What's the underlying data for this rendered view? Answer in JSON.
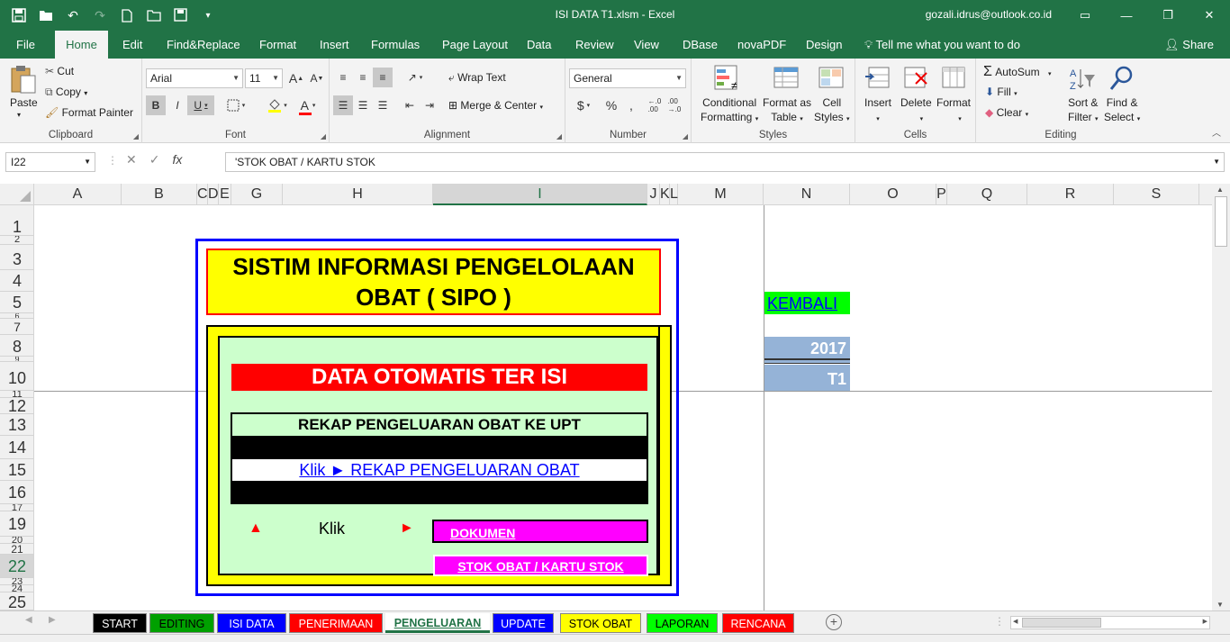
{
  "window": {
    "title": "ISI DATA T1.xlsm  -  Excel",
    "account": "gozali.idrus@outlook.co.id"
  },
  "ribbon_tabs": [
    "File",
    "Home",
    "Edit",
    "Find&Replace",
    "Format",
    "Insert",
    "Formulas",
    "Page Layout",
    "Data",
    "Review",
    "View",
    "DBase",
    "novaPDF",
    "Design"
  ],
  "active_tab": "Home",
  "tell_me": "Tell me what you want to do",
  "share_label": "Share",
  "clipboard": {
    "paste": "Paste",
    "cut": "Cut",
    "copy": "Copy",
    "format_painter": "Format Painter",
    "label": "Clipboard"
  },
  "font": {
    "name": "Arial",
    "size": "11",
    "bold": "B",
    "italic": "I",
    "underline": "U",
    "label": "Font"
  },
  "alignment": {
    "wrap_text": "Wrap Text",
    "merge_center": "Merge & Center",
    "label": "Alignment"
  },
  "number": {
    "format": "General",
    "currency": "$",
    "percent": "%",
    "comma": ",",
    "label": "Number"
  },
  "styles": {
    "conditional_1": "Conditional",
    "conditional_2": "Formatting",
    "format_table_1": "Format as",
    "format_table_2": "Table",
    "cell_styles_1": "Cell",
    "cell_styles_2": "Styles",
    "label": "Styles"
  },
  "cells": {
    "insert": "Insert",
    "delete": "Delete",
    "format": "Format",
    "label": "Cells"
  },
  "editing": {
    "autosum": "AutoSum",
    "fill": "Fill",
    "clear": "Clear",
    "sort_1": "Sort &",
    "sort_2": "Filter",
    "find_1": "Find &",
    "find_2": "Select",
    "label": "Editing"
  },
  "formula_bar": {
    "name_box": "I22",
    "formula": "'STOK OBAT / KARTU STOK"
  },
  "columns": [
    "A",
    "B",
    "C",
    "D",
    "E",
    "G",
    "H",
    "I",
    "J",
    "K",
    "L",
    "M",
    "N",
    "O",
    "P",
    "Q",
    "R",
    "S"
  ],
  "rows": [
    "1",
    "2",
    "3",
    "4",
    "5",
    "6",
    "7",
    "8",
    "9",
    "10",
    "11",
    "12",
    "13",
    "14",
    "15",
    "16",
    "17",
    "19",
    "20",
    "21",
    "22",
    "23",
    "24",
    "25"
  ],
  "dashboard": {
    "title_line1": "SISTIM INFORMASI PENGELOLAAN",
    "title_line2": "OBAT   ( SIPO )",
    "banner": "DATA OTOMATIS TER ISI",
    "rekap_title": "REKAP PENGELUARAN OBAT KE UPT",
    "rekap_link": "Klik ►  REKAP PENGELUARAN OBAT",
    "klik_arrow_up": "▲",
    "klik_label": "Klik",
    "klik_arrow_right": "►",
    "dokumen_button": "DOKUMEN",
    "stok_button": "STOK OBAT / KARTU STOK"
  },
  "side_panel": {
    "kembali": "KEMBALI",
    "year": "2017",
    "period": "T1"
  },
  "sheet_tabs": [
    {
      "label": "START",
      "bg": "#000000",
      "fg": "#ffffff"
    },
    {
      "label": "EDITING",
      "bg": "#00a000",
      "fg": "#000000"
    },
    {
      "label": "ISI DATA",
      "bg": "#0000ff",
      "fg": "#ffffff"
    },
    {
      "label": "PENERIMAAN",
      "bg": "#ff0000",
      "fg": "#ffffff"
    },
    {
      "label": "PENGELUARAN",
      "bg": "#ffffff",
      "fg": "#217346"
    },
    {
      "label": "UPDATE",
      "bg": "#0000ff",
      "fg": "#ffffff"
    },
    {
      "label": "STOK OBAT",
      "bg": "#ffff00",
      "fg": "#000000"
    },
    {
      "label": "LAPORAN",
      "bg": "#00ff00",
      "fg": "#000000"
    },
    {
      "label": "RENCANA",
      "bg": "#ff0000",
      "fg": "#ffffff"
    }
  ],
  "colors": {
    "excel_green": "#217346",
    "title_yellow": "#ffff00",
    "panel_green": "#ccffcc",
    "banner_red": "#ff0000",
    "magenta": "#ff00ff",
    "link_blue": "#0000ff",
    "side_blue": "#95b3d7"
  }
}
